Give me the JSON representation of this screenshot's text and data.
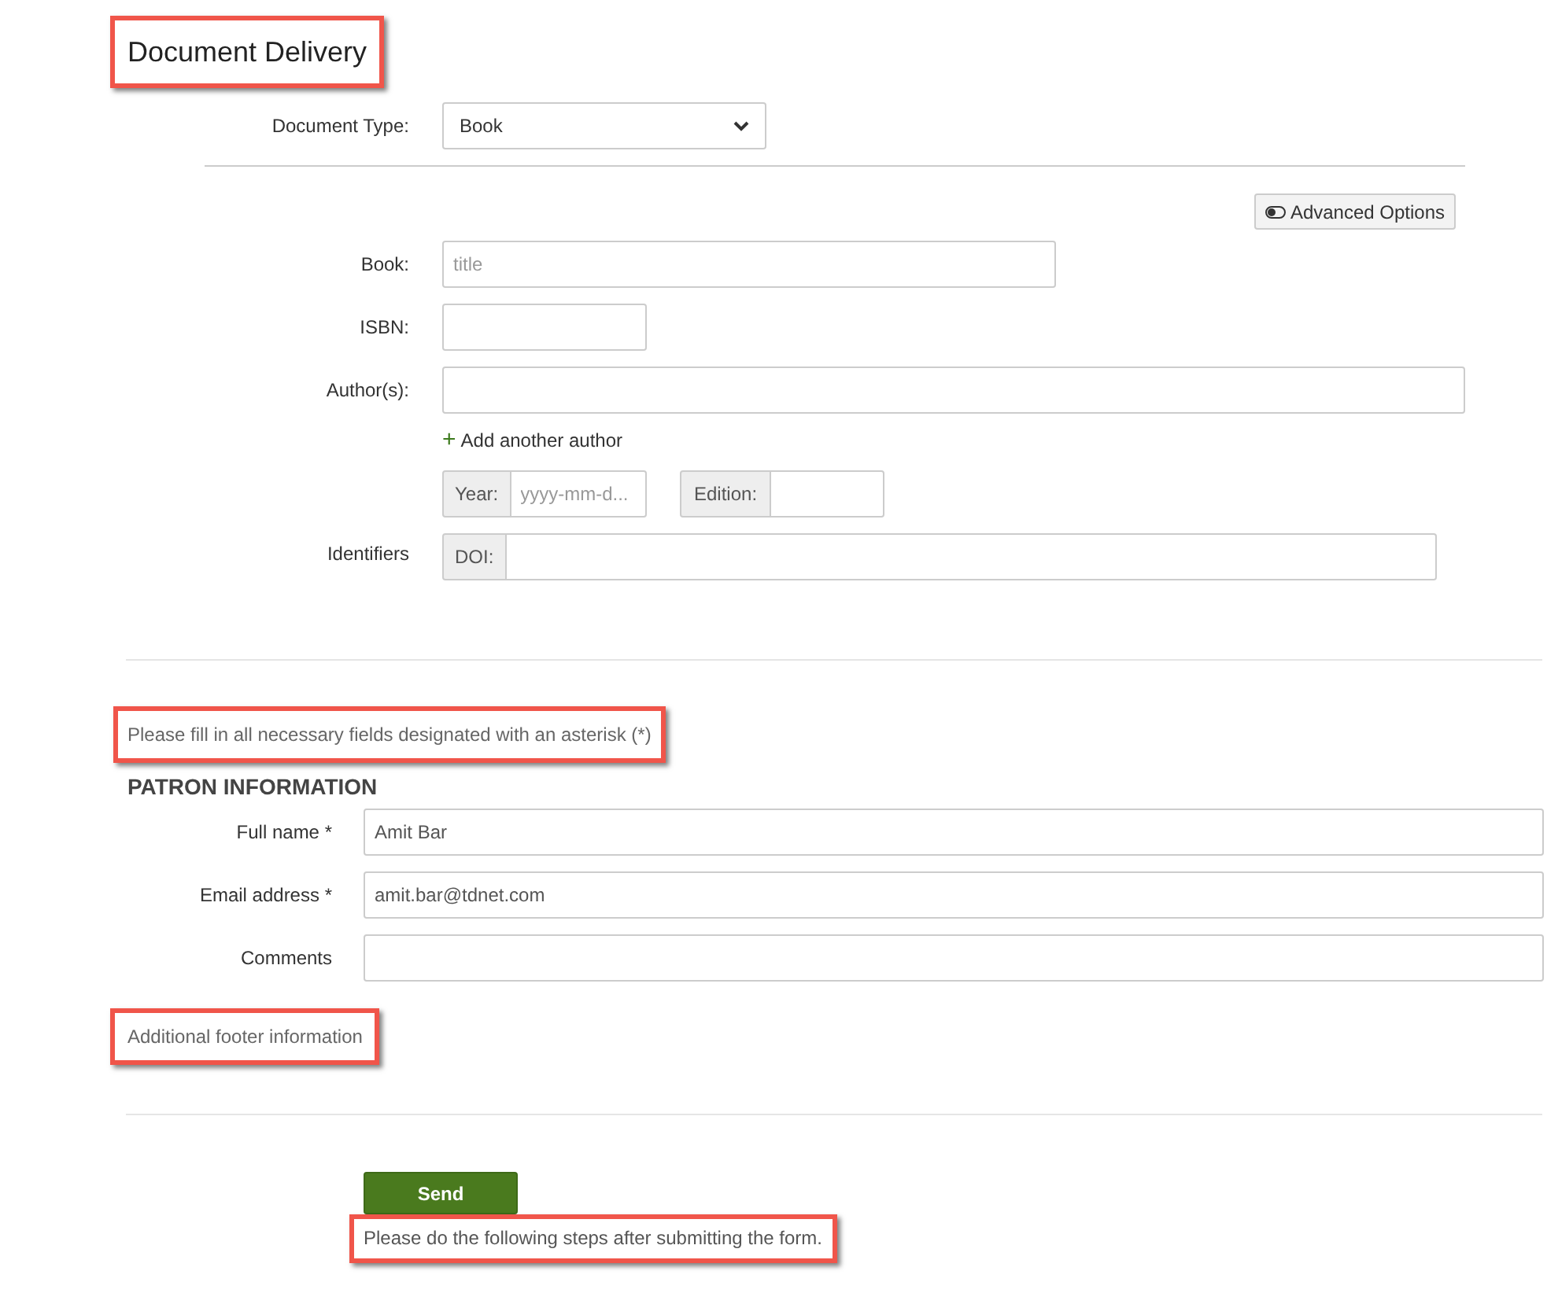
{
  "title": {
    "text": "Document Delivery",
    "highlighted": true
  },
  "document_type": {
    "label": "Document Type:",
    "value": "Book"
  },
  "advanced_options": {
    "label": "Advanced Options"
  },
  "book": {
    "label": "Book:",
    "placeholder": "title"
  },
  "isbn": {
    "label": "ISBN:"
  },
  "authors": {
    "label": "Author(s):",
    "add_link": "Add another author",
    "add_icon": "+"
  },
  "year": {
    "addon": "Year:",
    "placeholder": "yyyy-mm-d..."
  },
  "edition": {
    "addon": "Edition:"
  },
  "identifiers": {
    "label": "Identifiers",
    "addon": "DOI:"
  },
  "notice": {
    "text": "Please fill in all necessary fields designated with an asterisk (*)",
    "highlighted": true
  },
  "patron": {
    "heading": "PATRON INFORMATION",
    "fields": [
      {
        "label": "Full name *",
        "value": "Amit Bar"
      },
      {
        "label": "Email address *",
        "value": "amit.bar@tdnet.com"
      },
      {
        "label": "Comments"
      }
    ]
  },
  "footer": {
    "text": "Additional footer information",
    "highlighted": true
  },
  "send_button": "Send",
  "after_text": {
    "text": "Please do the following steps after submitting the form.",
    "highlighted": true
  }
}
